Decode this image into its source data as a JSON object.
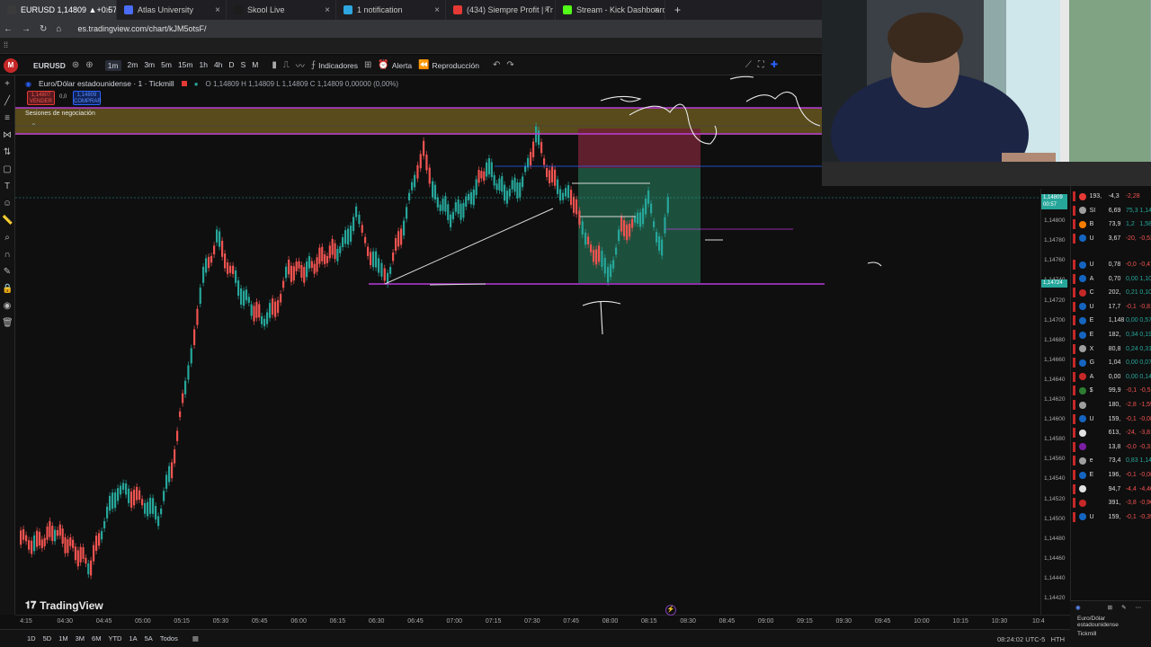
{
  "browser": {
    "tabs": [
      {
        "label": "EURUSD 1,14809 ▲+0.57% W",
        "color": "#3a3a3a",
        "active": true
      },
      {
        "label": "Atlas University",
        "color": "#4a6cf7"
      },
      {
        "label": "Skool Live",
        "color": "#1c1c1c"
      },
      {
        "label": "1 notification",
        "color": "#2ea6e0"
      },
      {
        "label": "(434) Siempre Profit | Tr",
        "color": "#e53935"
      },
      {
        "label": "Stream - Kick Dashboard",
        "color": "#53fc18"
      }
    ],
    "new_tab": "+",
    "url": "es.tradingview.com/chart/kJM5otsF/"
  },
  "toolbar": {
    "symbol": "EURUSD",
    "timeframes": [
      "1m",
      "2m",
      "3m",
      "5m",
      "15m",
      "1h",
      "4h",
      "D",
      "S",
      "M"
    ],
    "selected_timeframe": "1m",
    "indicators": "Indicadores",
    "alert": "Alerta",
    "replay": "Reproducción"
  },
  "legend": {
    "title": "Euro/Dólar estadounidense · 1 · Tickmill",
    "ohlc": "O 1,14809 H 1,14809 L 1,14809 C 1,14809 0,00000 (0,00%)",
    "sell_price": "1,14807",
    "sell_label": "VENDER",
    "spread": "0,0",
    "buy_price": "1,14809",
    "buy_label": "COMPRAR",
    "sessions": "Sesiones de negociación"
  },
  "brand": "TradingView",
  "price_axis": {
    "ticks": [
      "1,14820",
      "1,14800",
      "1,14780",
      "1,14760",
      "1,14740",
      "1,14720",
      "1,14700",
      "1,14680",
      "1,14660",
      "1,14640",
      "1,14620",
      "1,14600",
      "1,14580",
      "1,14560",
      "1,14540",
      "1,14520",
      "1,14500",
      "1,14480",
      "1,14460",
      "1,14440",
      "1,14420"
    ],
    "current_tag": "1,14809",
    "current_time": "00:57",
    "level_tag": "1,14724"
  },
  "time_axis": {
    "ticks": [
      "4:15",
      "04:30",
      "04:45",
      "05:00",
      "05:15",
      "05:30",
      "05:45",
      "06:00",
      "06:15",
      "06:30",
      "06:45",
      "07:00",
      "07:15",
      "07:30",
      "07:45",
      "08:00",
      "08:15",
      "08:30",
      "08:45",
      "09:00",
      "09:15",
      "09:30",
      "09:45",
      "10:00",
      "10:15",
      "10:30",
      "10:4"
    ]
  },
  "bottom": {
    "ranges": [
      "1D",
      "5D",
      "1M",
      "3M",
      "6M",
      "YTD",
      "1A",
      "5A",
      "Todos"
    ],
    "clock": "08:24:02 UTC-5",
    "session": "HTH"
  },
  "watchlist": [
    {
      "sym": "193,",
      "v1": "-4,3",
      "v2": "-2,28",
      "up": false,
      "color": "#e53935"
    },
    {
      "sym": "SI",
      "v1": "6,69",
      "v2": "75,3",
      "v3": "1,14",
      "up": true,
      "color": "#9e9e9e"
    },
    {
      "sym": "B",
      "v1": "73,9",
      "v2": "1,2",
      "v3": "1,58",
      "up": true,
      "color": "#f57c00"
    },
    {
      "sym": "U",
      "v1": "3,67",
      "v2": "-20,",
      "v3": "-0,53",
      "up": false,
      "color": "#1565c0"
    },
    {
      "sym": "U",
      "v1": "0,78",
      "v2": "-0,0",
      "v3": "-0,47",
      "up": false,
      "color": "#1565c0"
    },
    {
      "sym": "A",
      "v1": "0,70",
      "v2": "0,00",
      "v3": "1,10",
      "up": true,
      "color": "#1565c0"
    },
    {
      "sym": "C",
      "v1": "202,",
      "v2": "0,21",
      "v3": "0,10",
      "up": true,
      "color": "#c62828"
    },
    {
      "sym": "U",
      "v1": "17,7",
      "v2": "-0,1",
      "v3": "-0,81",
      "up": false,
      "color": "#1565c0"
    },
    {
      "sym": "E",
      "v1": "1,148",
      "v2": "0,00",
      "v3": "0,57",
      "up": true,
      "color": "#1565c0"
    },
    {
      "sym": "E",
      "v1": "182,",
      "v2": "0,34",
      "v3": "0,19",
      "up": true,
      "color": "#1565c0"
    },
    {
      "sym": "X",
      "v1": "80,8",
      "v2": "0,24",
      "v3": "0,31",
      "up": true,
      "color": "#9e9e9e"
    },
    {
      "sym": "G",
      "v1": "1,04",
      "v2": "0,00",
      "v3": "0,07",
      "up": true,
      "color": "#1565c0"
    },
    {
      "sym": "A",
      "v1": "0,00",
      "v2": "0,00",
      "v3": "0,14",
      "up": true,
      "color": "#c62828"
    },
    {
      "sym": "$",
      "v1": "99,9",
      "v2": "-0,1",
      "v3": "-0,5",
      "up": false,
      "color": "#2e7d32"
    },
    {
      "sym": "",
      "v1": "180,",
      "v2": "-2,8",
      "v3": "-1,59",
      "up": false,
      "color": "#9e9e9e"
    },
    {
      "sym": "U",
      "v1": "159,",
      "v2": "-0,1",
      "v3": "-0,08",
      "up": false,
      "color": "#1565c0"
    },
    {
      "sym": "",
      "v1": "613,",
      "v2": "-24,",
      "v3": "-3,81",
      "up": false,
      "color": "#e0e0e0"
    },
    {
      "sym": "",
      "v1": "13,8",
      "v2": "-0,0",
      "v3": "-0,31",
      "up": false,
      "color": "#7b1fa2"
    },
    {
      "sym": "e",
      "v1": "73,4",
      "v2": "0,83",
      "v3": "1,14",
      "up": true,
      "color": "#9e9e9e"
    },
    {
      "sym": "E",
      "v1": "196,",
      "v2": "-0,1",
      "v3": "-0,08",
      "up": false,
      "color": "#1565c0"
    },
    {
      "sym": "",
      "v1": "94,7",
      "v2": "-4,4",
      "v3": "-4,40",
      "up": false,
      "color": "#e0e0e0"
    },
    {
      "sym": "",
      "v1": "391,",
      "v2": "-3,8",
      "v3": "-0,96",
      "up": false,
      "color": "#c62828"
    },
    {
      "sym": "U",
      "v1": "159,",
      "v2": "-0,1",
      "v3": "-0,39",
      "up": false,
      "color": "#1565c0"
    }
  ],
  "watchlist_footer": {
    "name": "Euro/Dólar estadounidense",
    "broker": "Tickmill"
  },
  "colors": {
    "up": "#26a69a",
    "down": "#ef5350",
    "magenta_line": "#b93ad8",
    "session_band": "#6b5a1e",
    "tp_zone": "#1f5c45",
    "sl_zone": "#6e2233"
  }
}
